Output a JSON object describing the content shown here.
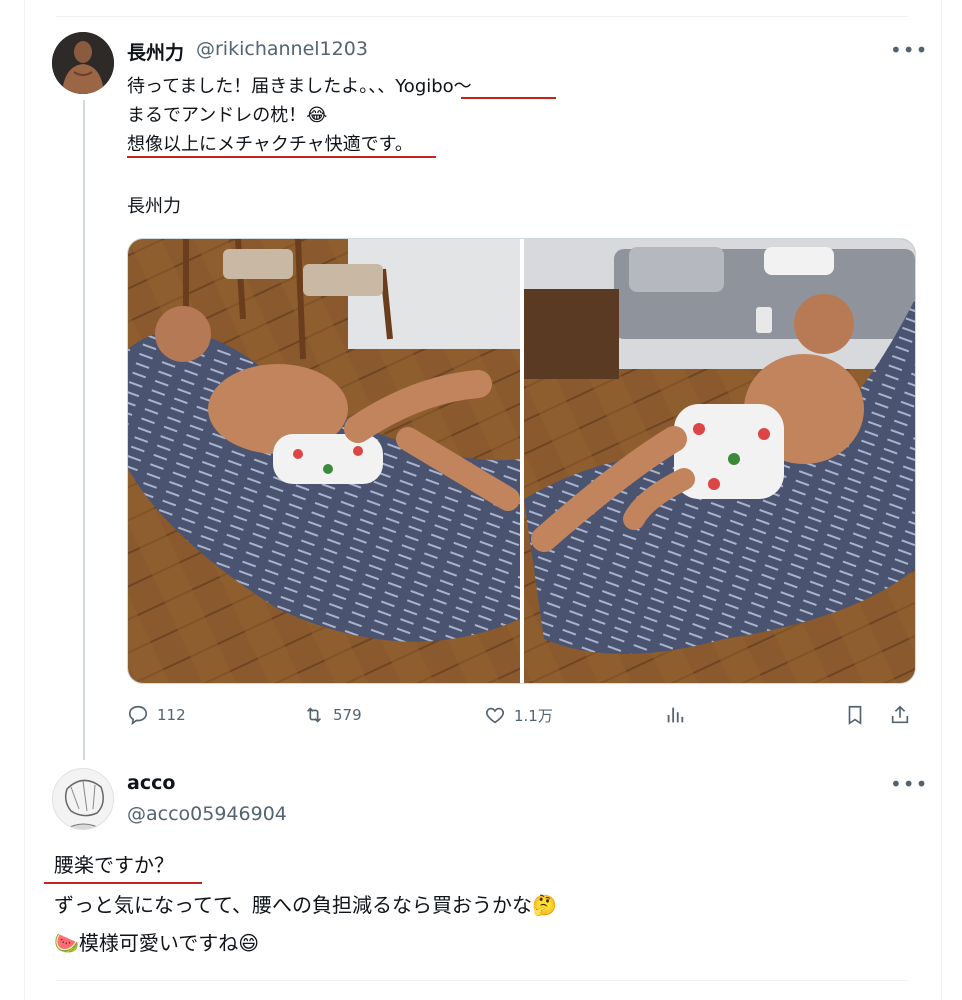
{
  "tweet1": {
    "author_name": "長州力",
    "author_handle": "@rikichannel1203",
    "more_label": "•••",
    "lines": [
      "待ってました！届きましたよ。、、Yogibo〜",
      "まるでアンドレの枕！😂",
      "想像以上にメチャクチャ快適です。",
      "長州力"
    ],
    "actions": {
      "reply_count": "112",
      "retweet_count": "579",
      "like_count": "1.1万"
    }
  },
  "tweet2": {
    "author_name": "acco",
    "author_handle": "@acco05946904",
    "more_label": "•••",
    "lines": [
      "腰楽ですか？",
      "ずっと気になってて、腰への負担減るなら買おうかな🤔",
      "🍉模様可愛いですね😄"
    ]
  },
  "colors": {
    "underline": "#c6211d",
    "secondary_text": "#536471",
    "thread_line": "#cfd9de"
  },
  "icons": [
    "reply-icon",
    "retweet-icon",
    "like-icon",
    "views-icon",
    "bookmark-icon",
    "share-icon"
  ]
}
